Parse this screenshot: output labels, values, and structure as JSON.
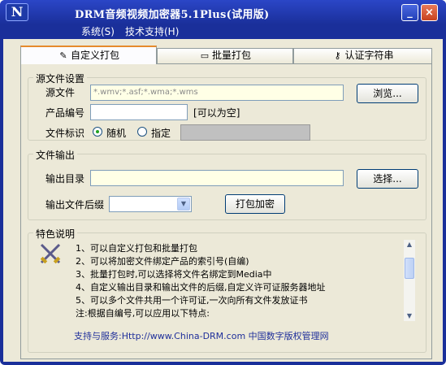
{
  "window": {
    "app_icon": "N",
    "title": "DRM音频视频加密器5.1Plus(试用版)",
    "minimize_icon": "minimize-icon",
    "close_icon": "close-icon",
    "minimize_glyph": "_",
    "close_glyph": "×"
  },
  "menu": {
    "items": [
      "系统(S)",
      "技术支持(H)"
    ]
  },
  "tabs": [
    {
      "label": "自定义打包",
      "icon": "pen-icon",
      "active": true
    },
    {
      "label": "批量打包",
      "icon": "folder-icon",
      "active": false
    },
    {
      "label": "认证字符串",
      "icon": "key-icon",
      "active": false
    }
  ],
  "source": {
    "group_title": "源文件设置",
    "file_label": "源文件",
    "file_value": "*.wmv;*.asf;*.wma;*.wms",
    "browse_button": "浏览...",
    "product_label": "产品编号",
    "product_value": "",
    "product_hint": "可以为空",
    "id_label": "文件标识",
    "radio_random": "随机",
    "radio_specify": "指定",
    "selected": "random",
    "specify_value": ""
  },
  "output": {
    "group_title": "文件输出",
    "dir_label": "输出目录",
    "dir_value": "",
    "select_button": "选择...",
    "suffix_label": "输出文件后缀",
    "suffix_value": "",
    "pack_button": "打包加密"
  },
  "features": {
    "group_title": "特色说明",
    "icon": "crossed-swords-icon",
    "lines": [
      "1、可以自定义打包和批量打包",
      "2、可以将加密文件绑定产品的索引号(自编)",
      "3、批量打包时,可以选择将文件名绑定到Media中",
      "4、自定义输出目录和输出文件的后缀,自定义许可证服务器地址",
      "5、可以多个文件共用一个许可证,一次向所有文件发放证书",
      "注:根据自编号,可以应用以下特点:"
    ],
    "support": "支持与服务:Http://www.China-DRM.com 中国数字版权管理网"
  }
}
